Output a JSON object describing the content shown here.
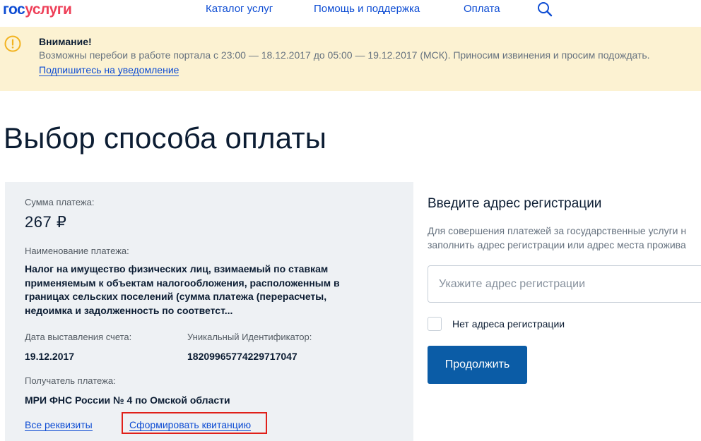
{
  "header": {
    "logo_part1": "гос",
    "logo_part2": "услуги",
    "nav": [
      "Каталог услуг",
      "Помощь и поддержка",
      "Оплата"
    ],
    "search_icon": "search-icon"
  },
  "alert": {
    "icon": "warning-icon",
    "title": "Внимание!",
    "text": "Возможны перебои в работе портала с 23:00 — 18.12.2017 до 05:00 — 19.12.2017 (МСК). Приносим извинения и просим подождать.",
    "link": "Подпишитесь на уведомление"
  },
  "page_title": "Выбор способа оплаты",
  "payment": {
    "amount_label": "Сумма платежа:",
    "amount": "267 ₽",
    "name_label": "Наименование платежа:",
    "name": "Налог на имущество физических лиц, взимаемый по ставкам применяемым к объектам налогообложения, расположенным в границах сельских поселений (сумма платежа (перерасчеты, недоимка и задолженность по соответст...",
    "date_label": "Дата выставления счета:",
    "date": "19.12.2017",
    "uid_label": "Уникальный Идентификатор:",
    "uid": "18209965774229717047",
    "recipient_label": "Получатель платежа:",
    "recipient": "МРИ ФНС России № 4 по Омской области",
    "details_link": "Все реквизиты",
    "receipt_link": "Сформировать квитанцию"
  },
  "address": {
    "title": "Введите адрес регистрации",
    "text_line1": "Для совершения платежей за государственные услуги н",
    "text_line2": "заполнить адрес регистрации или адрес места прожива",
    "placeholder": "Укажите адрес регистрации",
    "value": "",
    "checkbox_label": "Нет адреса регистрации",
    "continue_button": "Продолжить"
  },
  "colors": {
    "brand_blue": "#0d4cd3",
    "brand_red": "#ee3f58",
    "alert_bg": "#fcf2d2",
    "button": "#0b5ca6",
    "highlight_border": "#e0201a"
  }
}
